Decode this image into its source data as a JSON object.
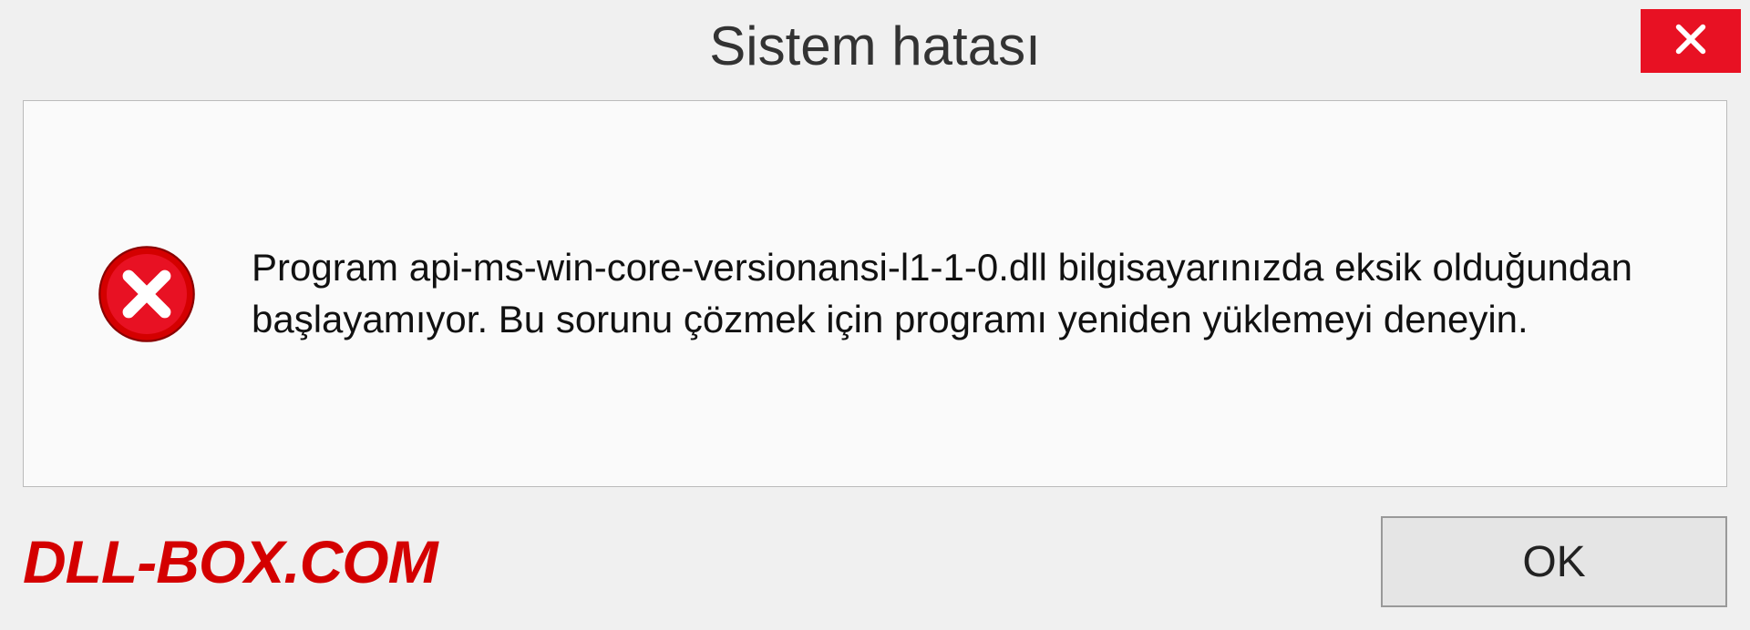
{
  "dialog": {
    "title": "Sistem hatası",
    "message": "Program api-ms-win-core-versionansi-l1-1-0.dll bilgisayarınızda eksik olduğundan başlayamıyor. Bu sorunu çözmek için programı yeniden yüklemeyi deneyin.",
    "ok_label": "OK"
  },
  "watermark": {
    "text": "DLL-BOX.COM"
  }
}
